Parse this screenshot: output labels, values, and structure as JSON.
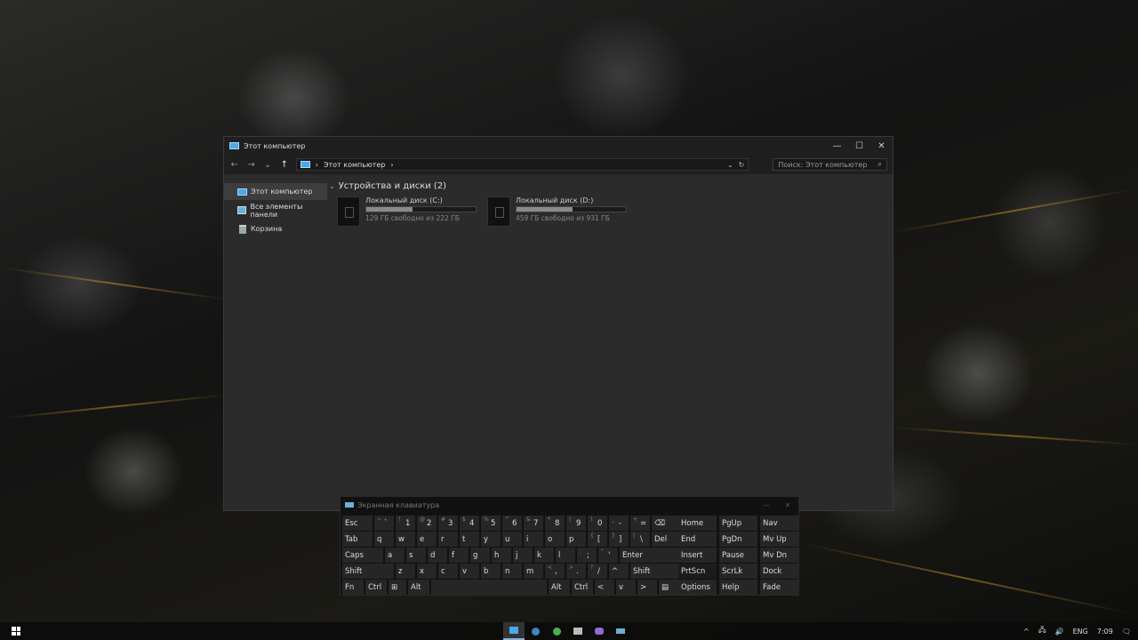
{
  "explorer": {
    "title": "Этот компьютер",
    "window_buttons": {
      "minimize": "—",
      "maximize": "☐",
      "close": "✕"
    },
    "nav": {
      "back": "←",
      "forward": "→",
      "recent": "⌄",
      "up": "↑"
    },
    "address": {
      "location": "Этот компьютер",
      "separator": "›",
      "trailing_separator": "›",
      "dropdown": "⌄",
      "refresh": "↻"
    },
    "search": {
      "placeholder": "Поиск: Этот компьютер",
      "icon": "⌕"
    },
    "sidebar": [
      {
        "label": "Этот компьютер",
        "icon": "computer-icon",
        "active": true
      },
      {
        "label": "Все элементы панели",
        "icon": "control-panel-icon",
        "active": false
      },
      {
        "label": "Корзина",
        "icon": "recycle-bin-icon",
        "active": false
      }
    ],
    "group_title": "Устройства и диски (2)",
    "drives": [
      {
        "name": "Локальный диск (C:)",
        "free_text": "129 ГБ свободно из 222 ГБ",
        "used_fraction": 0.42
      },
      {
        "name": "Локальный диск (D:)",
        "free_text": "459 ГБ свободно из 931 ГБ",
        "used_fraction": 0.51
      }
    ]
  },
  "osk": {
    "title": "Экранная клавиатура",
    "buttons": {
      "minimize": "—",
      "close": "✕"
    },
    "rows": [
      [
        {
          "label": "Esc",
          "w": 1
        },
        {
          "label": "`",
          "shift": "~"
        },
        {
          "label": "1",
          "shift": "!"
        },
        {
          "label": "2",
          "shift": "@"
        },
        {
          "label": "3",
          "shift": "#"
        },
        {
          "label": "4",
          "shift": "$"
        },
        {
          "label": "5",
          "shift": "%"
        },
        {
          "label": "6",
          "shift": "^"
        },
        {
          "label": "7",
          "shift": "&"
        },
        {
          "label": "8",
          "shift": "*"
        },
        {
          "label": "9",
          "shift": "("
        },
        {
          "label": "0",
          "shift": ")"
        },
        {
          "label": "-",
          "shift": "_"
        },
        {
          "label": "=",
          "shift": "+"
        },
        {
          "label": "⌫"
        }
      ],
      [
        {
          "label": "Tab"
        },
        {
          "label": "q"
        },
        {
          "label": "w"
        },
        {
          "label": "e"
        },
        {
          "label": "r"
        },
        {
          "label": "t"
        },
        {
          "label": "y"
        },
        {
          "label": "u"
        },
        {
          "label": "i"
        },
        {
          "label": "o"
        },
        {
          "label": "p"
        },
        {
          "label": "[",
          "shift": "{"
        },
        {
          "label": "]",
          "shift": "}"
        },
        {
          "label": "\\",
          "shift": "|"
        },
        {
          "label": "Del"
        }
      ],
      [
        {
          "label": "Caps"
        },
        {
          "label": "a"
        },
        {
          "label": "s"
        },
        {
          "label": "d"
        },
        {
          "label": "f"
        },
        {
          "label": "g"
        },
        {
          "label": "h"
        },
        {
          "label": "j"
        },
        {
          "label": "k"
        },
        {
          "label": "l"
        },
        {
          "label": ";",
          "shift": ":"
        },
        {
          "label": "'",
          "shift": "\""
        },
        {
          "label": "Enter"
        }
      ],
      [
        {
          "label": "Shift"
        },
        {
          "label": "z"
        },
        {
          "label": "x"
        },
        {
          "label": "c"
        },
        {
          "label": "v"
        },
        {
          "label": "b"
        },
        {
          "label": "n"
        },
        {
          "label": "m"
        },
        {
          "label": ",",
          "shift": "<"
        },
        {
          "label": ".",
          "shift": ">"
        },
        {
          "label": "/",
          "shift": "?"
        },
        {
          "label": "^"
        },
        {
          "label": "Shift"
        }
      ],
      [
        {
          "label": "Fn"
        },
        {
          "label": "Ctrl"
        },
        {
          "label": "⊞"
        },
        {
          "label": "Alt"
        },
        {
          "label": ""
        },
        {
          "label": "Alt"
        },
        {
          "label": "Ctrl"
        },
        {
          "label": "<"
        },
        {
          "label": "v"
        },
        {
          "label": ">"
        },
        {
          "label": "▤"
        }
      ]
    ],
    "side_keys": [
      [
        "Home",
        "PgUp",
        "Nav"
      ],
      [
        "End",
        "PgDn",
        "Mv Up"
      ],
      [
        "Insert",
        "Pause",
        "Mv Dn"
      ],
      [
        "PrtScn",
        "ScrLk",
        "Dock"
      ],
      [
        "Options",
        "Help",
        "Fade"
      ]
    ]
  },
  "taskbar": {
    "tray": {
      "chevron": "^",
      "network": "🖧",
      "volume": "🔊",
      "language": "ENG",
      "time": "7:09",
      "notifications": "🗨"
    }
  },
  "colors": {
    "accent": "#4aa8e8",
    "window_bg": "#2b2b2b",
    "titlebar": "#1f1f1f"
  }
}
